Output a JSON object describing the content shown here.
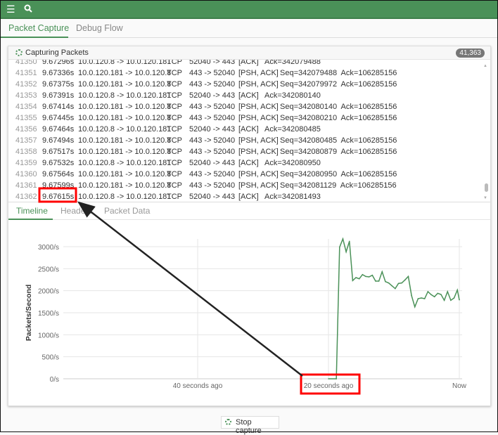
{
  "toolbar": {
    "menu_icon": "hamburger-menu-icon",
    "search_icon": "search-icon"
  },
  "tabs": [
    {
      "label": "Packet Capture",
      "active": true
    },
    {
      "label": "Debug Flow",
      "active": false
    }
  ],
  "panel": {
    "title": "Capturing Packets",
    "count": "41,363"
  },
  "packets": [
    {
      "num": "41350",
      "time": "9.67296s",
      "addr": "10.0.120.8 -> 10.0.120.181",
      "proto": "TCP",
      "ports": "52040 -> 443",
      "flags": "[ACK]",
      "info": "Ack=342079488"
    },
    {
      "num": "41351",
      "time": "9.67336s",
      "addr": "10.0.120.181 -> 10.0.120.8",
      "proto": "TCP",
      "ports": "443 -> 52040",
      "flags": "[PSH, ACK]",
      "info": "Seq=342079488  Ack=106285156"
    },
    {
      "num": "41352",
      "time": "9.67375s",
      "addr": "10.0.120.181 -> 10.0.120.8",
      "proto": "TCP",
      "ports": "443 -> 52040",
      "flags": "[PSH, ACK]",
      "info": "Seq=342079972  Ack=106285156"
    },
    {
      "num": "41353",
      "time": "9.67391s",
      "addr": "10.0.120.8 -> 10.0.120.181",
      "proto": "TCP",
      "ports": "52040 -> 443",
      "flags": "[ACK]",
      "info": "Ack=342080140"
    },
    {
      "num": "41354",
      "time": "9.67414s",
      "addr": "10.0.120.181 -> 10.0.120.8",
      "proto": "TCP",
      "ports": "443 -> 52040",
      "flags": "[PSH, ACK]",
      "info": "Seq=342080140  Ack=106285156"
    },
    {
      "num": "41355",
      "time": "9.67445s",
      "addr": "10.0.120.181 -> 10.0.120.8",
      "proto": "TCP",
      "ports": "443 -> 52040",
      "flags": "[PSH, ACK]",
      "info": "Seq=342080210  Ack=106285156"
    },
    {
      "num": "41356",
      "time": "9.67464s",
      "addr": "10.0.120.8 -> 10.0.120.181",
      "proto": "TCP",
      "ports": "52040 -> 443",
      "flags": "[ACK]",
      "info": "Ack=342080485"
    },
    {
      "num": "41357",
      "time": "9.67494s",
      "addr": "10.0.120.181 -> 10.0.120.8",
      "proto": "TCP",
      "ports": "443 -> 52040",
      "flags": "[PSH, ACK]",
      "info": "Seq=342080485  Ack=106285156"
    },
    {
      "num": "41358",
      "time": "9.67517s",
      "addr": "10.0.120.181 -> 10.0.120.8",
      "proto": "TCP",
      "ports": "443 -> 52040",
      "flags": "[PSH, ACK]",
      "info": "Seq=342080879  Ack=106285156"
    },
    {
      "num": "41359",
      "time": "9.67532s",
      "addr": "10.0.120.8 -> 10.0.120.181",
      "proto": "TCP",
      "ports": "52040 -> 443",
      "flags": "[ACK]",
      "info": "Ack=342080950"
    },
    {
      "num": "41360",
      "time": "9.67564s",
      "addr": "10.0.120.181 -> 10.0.120.8",
      "proto": "TCP",
      "ports": "443 -> 52040",
      "flags": "[PSH, ACK]",
      "info": "Seq=342080950  Ack=106285156"
    },
    {
      "num": "41361",
      "time": "9.67599s",
      "addr": "10.0.120.181 -> 10.0.120.8",
      "proto": "TCP",
      "ports": "443 -> 52040",
      "flags": "[PSH, ACK]",
      "info": "Seq=342081129  Ack=106285156"
    },
    {
      "num": "41362",
      "time": "9.67615s",
      "addr": "10.0.120.8 -> 10.0.120.181",
      "proto": "TCP",
      "ports": "52040 -> 443",
      "flags": "[ACK]",
      "info": "Ack=342081493"
    }
  ],
  "detail_tabs": [
    {
      "label": "Timeline",
      "active": true
    },
    {
      "label": "Headers",
      "active": false
    },
    {
      "label": "Packet Data",
      "active": false
    }
  ],
  "chart_data": {
    "type": "line",
    "ylabel": "Packets/Second",
    "xlim": [
      -60,
      0
    ],
    "ylim": [
      0,
      3000
    ],
    "yticks": [
      {
        "v": 0,
        "label": "0/s"
      },
      {
        "v": 500,
        "label": "500/s"
      },
      {
        "v": 1000,
        "label": "1000/s"
      },
      {
        "v": 1500,
        "label": "1500/s"
      },
      {
        "v": 2000,
        "label": "2000/s"
      },
      {
        "v": 2500,
        "label": "2500/s"
      },
      {
        "v": 3000,
        "label": "3000/s"
      }
    ],
    "xticks": [
      {
        "v": -40,
        "label": "40 seconds ago"
      },
      {
        "v": -20,
        "label": "20 seconds ago"
      },
      {
        "v": 0,
        "label": "Now"
      }
    ],
    "color": "#4a9158",
    "x": [
      -20,
      -18.8,
      -18.3,
      -17.8,
      -17.3,
      -16.8,
      -16.3,
      -15.8,
      -15.3,
      -14.8,
      -14.3,
      -13.8,
      -13.3,
      -12.8,
      -12.3,
      -11.8,
      -11.3,
      -10.8,
      -10.3,
      -9.8,
      -9.3,
      -8.8,
      -8.3,
      -7.8,
      -7.3,
      -6.8,
      -6.3,
      -5.8,
      -5.3,
      -4.8,
      -4.3,
      -3.8,
      -3.3,
      -2.8,
      -2.3,
      -1.8,
      -1.3,
      -0.8,
      -0.3,
      0
    ],
    "y": [
      0,
      0,
      2989,
      3176,
      2883,
      3122,
      2229,
      2298,
      2271,
      2367,
      2324,
      2314,
      2351,
      2218,
      2218,
      2431,
      2207,
      2176,
      2112,
      2048,
      2165,
      2176,
      2245,
      2324,
      1888,
      1633,
      1819,
      1835,
      1819,
      1979,
      1910,
      1862,
      1941,
      1915,
      1782,
      1979,
      1782,
      1835,
      2016,
      1793
    ]
  },
  "footer": {
    "stop_label": "Stop capture"
  },
  "annotation": {
    "color": "#ff0000"
  }
}
